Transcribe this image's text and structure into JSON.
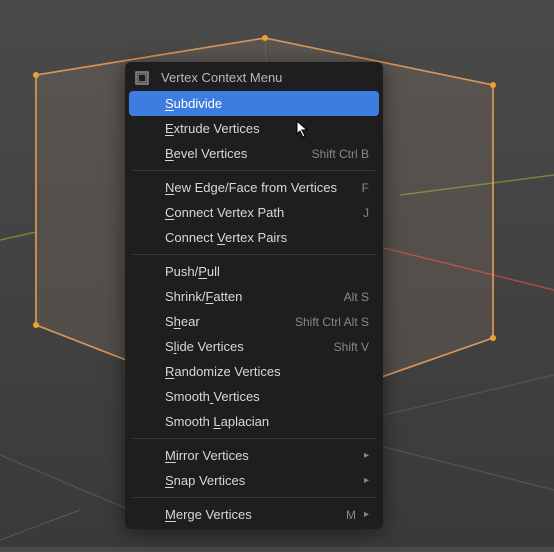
{
  "header": {
    "title": "Vertex Context Menu"
  },
  "items": [
    {
      "label": "Subdivide",
      "u": 0,
      "shortcut": "",
      "highlighted": true
    },
    {
      "label": "Extrude Vertices",
      "u": 0,
      "shortcut": ""
    },
    {
      "label": "Bevel Vertices",
      "u": 0,
      "shortcut": "Shift Ctrl B"
    },
    {
      "divider": true
    },
    {
      "label": "New Edge/Face from Vertices",
      "u": 0,
      "shortcut": "F"
    },
    {
      "label": "Connect Vertex Path",
      "u": 0,
      "shortcut": "J"
    },
    {
      "label": "Connect Vertex Pairs",
      "u": 8,
      "shortcut": ""
    },
    {
      "divider": true
    },
    {
      "label": "Push/Pull",
      "u": 5,
      "shortcut": ""
    },
    {
      "label": "Shrink/Fatten",
      "u": 7,
      "shortcut": "Alt S"
    },
    {
      "label": "Shear",
      "u": 1,
      "shortcut": "Shift Ctrl Alt S"
    },
    {
      "label": "Slide Vertices",
      "u": 1,
      "shortcut": "Shift V"
    },
    {
      "label": "Randomize Vertices",
      "u": 0,
      "shortcut": ""
    },
    {
      "label": "Smooth Vertices",
      "u": 6,
      "shortcut": ""
    },
    {
      "label": "Smooth Laplacian",
      "u": 7,
      "shortcut": ""
    },
    {
      "divider": true
    },
    {
      "label": "Mirror Vertices",
      "u": 0,
      "shortcut": "",
      "submenu": true
    },
    {
      "label": "Snap Vertices",
      "u": 0,
      "shortcut": "",
      "submenu": true
    },
    {
      "divider": true
    },
    {
      "label": "Merge Vertices",
      "u": 0,
      "shortcut": "M",
      "submenu": true
    }
  ]
}
